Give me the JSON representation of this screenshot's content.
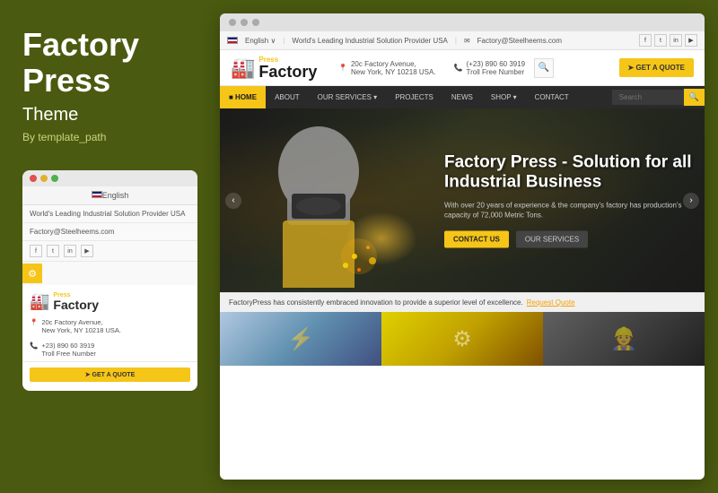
{
  "left": {
    "title": "Factory Press",
    "subtitle": "Theme",
    "author": "By template_path"
  },
  "mobile": {
    "language": "English",
    "tagline": "World's Leading Industrial Solution Provider USA",
    "email": "Factory@Steelheems.com",
    "social": [
      "f",
      "t",
      "in",
      "▶"
    ],
    "logo_press": "Press",
    "logo_factory": "Factory",
    "address_line1": "20c Factory Avenue,",
    "address_line2": "New York, NY 10218 USA.",
    "phone": "+23) 890 60 3919",
    "phone_sub": "Troll Free Number"
  },
  "site": {
    "top_bar": {
      "tagline": "World's Leading Industrial Solution Provider USA",
      "email": "Factory@Steelheems.com",
      "social": [
        "f",
        "t",
        "in",
        "▶"
      ]
    },
    "header": {
      "logo_press": "Press",
      "logo_factory": "Factory",
      "address_line1": "20c Factory Avenue,",
      "address_line2": "New York, NY 10218 USA.",
      "phone_number": "(+23) 890 60 3919",
      "phone_sub": "Troll Free Number",
      "cta": "GET A QUOTE"
    },
    "nav": {
      "items": [
        "HOME",
        "ABOUT",
        "OUR SERVICES",
        "PROJECTS",
        "NEWS",
        "SHOP",
        "CONTACT"
      ],
      "search_placeholder": "Search"
    },
    "hero": {
      "title": "Factory Press - Solution for all Industrial Business",
      "description": "With over 20 years of experience & the company's factory has production's capacity of 72,000 Metric Tons.",
      "btn_contact": "CONTACT US",
      "btn_services": "OUR SERVICES"
    },
    "bottom_bar": {
      "text": "FactoryPress has consistently embraced innovation to provide a superior level of excellence.",
      "link_text": "Request Quote"
    }
  }
}
